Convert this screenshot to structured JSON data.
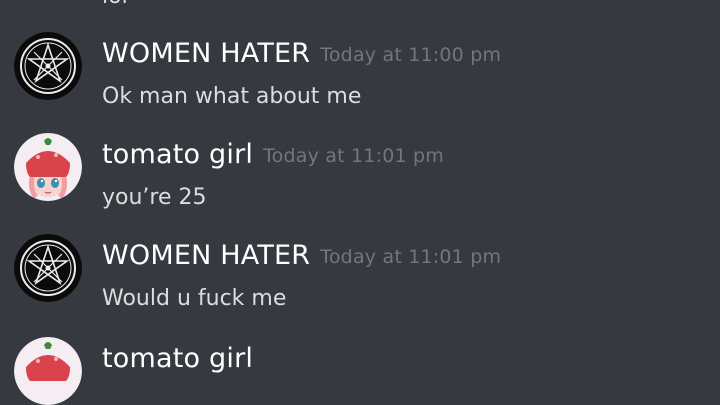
{
  "top_fragment": "lol",
  "messages": [
    {
      "author": "WOMEN HATER",
      "time": "Today at 11:00 pm",
      "content": "Ok man what about me",
      "avatar": "pentagram-icon"
    },
    {
      "author": "tomato girl",
      "time": "Today at 11:01 pm",
      "content": "you’re 25",
      "avatar": "tomato-girl-icon"
    },
    {
      "author": "WOMEN HATER",
      "time": "Today at 11:01 pm",
      "content": "Would u fuck me",
      "avatar": "pentagram-icon"
    },
    {
      "author": "tomato girl",
      "time": "",
      "content": "",
      "avatar": "tomato-girl-icon"
    }
  ],
  "colors": {
    "background": "#36393f",
    "username": "#ffffff",
    "timestamp": "#72767d",
    "message_text": "#dcddde"
  }
}
